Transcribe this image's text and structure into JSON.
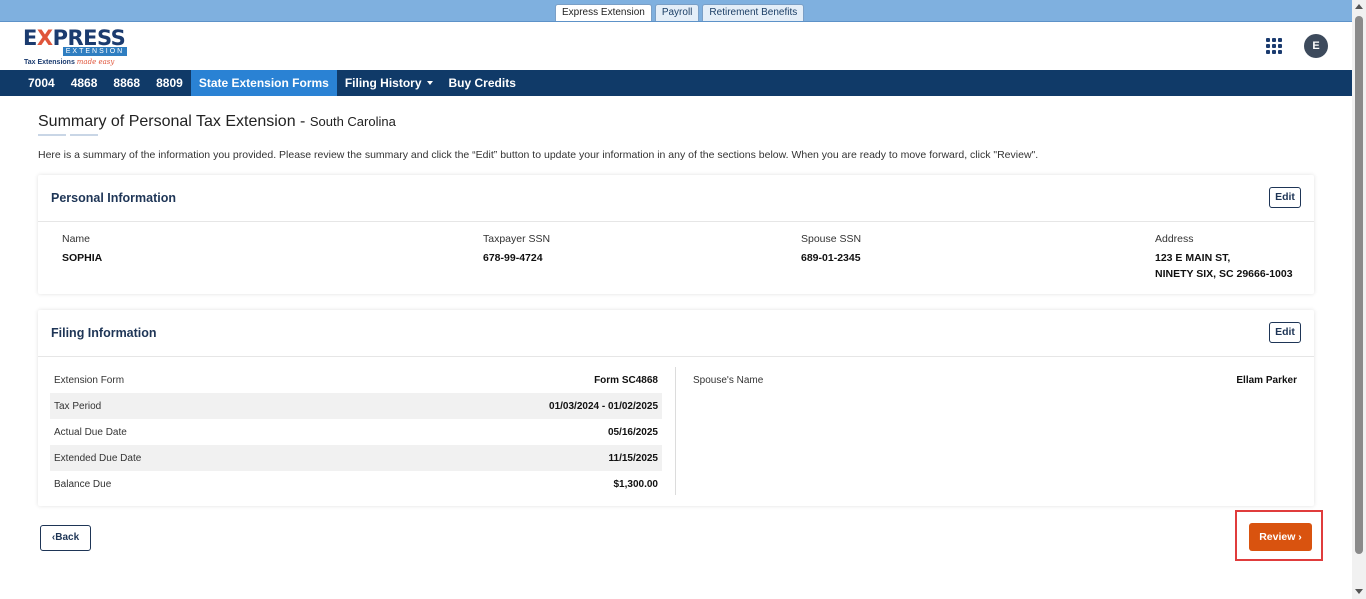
{
  "app_tabs": [
    {
      "label": "Express Extension",
      "active": true
    },
    {
      "label": "Payroll",
      "active": false
    },
    {
      "label": "Retirement Benefits",
      "active": false
    }
  ],
  "header": {
    "logo": {
      "word_pre": "E",
      "word_x": "X",
      "word_post": "PRESS",
      "band": "EXTENSION",
      "tagline": "Tax Extensions",
      "tagline_cursive": "made easy"
    },
    "avatar_initial": "E"
  },
  "nav": {
    "items": [
      {
        "label": "7004"
      },
      {
        "label": "4868"
      },
      {
        "label": "8868"
      },
      {
        "label": "8809"
      },
      {
        "label": "State Extension Forms",
        "active": true
      },
      {
        "label": "Filing History",
        "dropdown": true
      },
      {
        "label": "Buy Credits"
      }
    ]
  },
  "page": {
    "title": "Summary of Personal Tax Extension",
    "title_sep": " - ",
    "state": "South Carolina",
    "intro": "Here is a summary of the information you provided. Please review the summary and click the “Edit” button to update your information in any of the sections below. When you are ready to move forward, click \"Review\"."
  },
  "personal": {
    "title": "Personal Information",
    "edit_label": "Edit",
    "name_label": "Name",
    "name": "SOPHIA",
    "taxpayer_ssn_label": "Taxpayer SSN",
    "taxpayer_ssn": "678-99-4724",
    "spouse_ssn_label": "Spouse SSN",
    "spouse_ssn": "689-01-2345",
    "address_label": "Address",
    "address_line1": "123 E MAIN ST,",
    "address_line2": "NINETY SIX, SC 29666-1003"
  },
  "filing": {
    "title": "Filing Information",
    "edit_label": "Edit",
    "rows": [
      {
        "label": "Extension Form",
        "value": "Form SC4868"
      },
      {
        "label": "Tax Period",
        "value": "01/03/2024 - 01/02/2025"
      },
      {
        "label": "Actual Due Date",
        "value": "05/16/2025"
      },
      {
        "label": "Extended Due Date",
        "value": "11/15/2025"
      },
      {
        "label": "Balance Due",
        "value": "$1,300.00"
      }
    ],
    "spouse_name_label": "Spouse's Name",
    "spouse_name": "Ellam Parker"
  },
  "actions": {
    "back_label": "Back",
    "review_label": "Review"
  },
  "colors": {
    "navbar": "#103a68",
    "nav_active": "#2a82d4",
    "review": "#d9530f",
    "highlight": "#e03c3c"
  }
}
